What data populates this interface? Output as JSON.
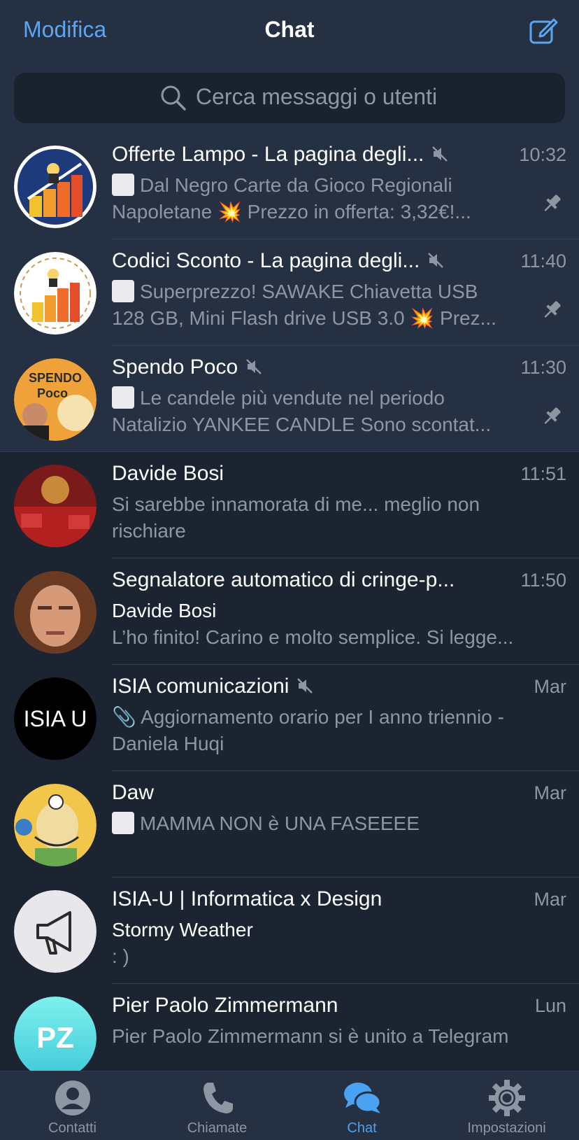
{
  "header": {
    "edit_label": "Modifica",
    "title": "Chat",
    "compose_icon": "compose-icon"
  },
  "search": {
    "placeholder": "Cerca messaggi o utenti"
  },
  "colors": {
    "accent": "#5aa6f5",
    "background": "#1c2431",
    "pinned_background": "#253042",
    "secondary_text": "#8e96a3"
  },
  "chats": [
    {
      "name": "Offerte Lampo - La pagina degli...",
      "time": "10:32",
      "muted": true,
      "pinned": true,
      "line1": "Dal Negro Carte da Gioco Regionali",
      "line2": "Napoletane 💥 Prezzo in offerta: 3,32€!..."
    },
    {
      "name": "Codici Sconto - La pagina degli...",
      "time": "11:40",
      "muted": true,
      "pinned": true,
      "line1": "Superprezzo! SAWAKE Chiavetta USB",
      "line2": "128 GB, Mini Flash drive USB 3.0 💥 Prez..."
    },
    {
      "name": "Spendo Poco",
      "time": "11:30",
      "muted": true,
      "pinned": true,
      "line1": "Le candele più vendute  nel periodo",
      "line2": "Natalizio YANKEE CANDLE  Sono scontat..."
    },
    {
      "name": "Davide Bosi",
      "time": "11:51",
      "line1": "Si sarebbe innamorata di me... meglio non",
      "line2": "rischiare"
    },
    {
      "name": "Segnalatore automatico di cringe-p...",
      "time": "11:50",
      "sender": "Davide Bosi",
      "line2": "L’ho finito! Carino e molto semplice. Si legge..."
    },
    {
      "name": "ISIA comunicazioni",
      "time": "Mar",
      "muted": true,
      "avatar_text": "ISIA U",
      "line1": "📎 Aggiornamento orario per  I anno triennio -",
      "line2": "Daniela Huqi"
    },
    {
      "name": "Daw",
      "time": "Mar",
      "line1": "MAMMA NON è UNA FASEEEE"
    },
    {
      "name": "ISIA-U | Informatica x Design",
      "time": "Mar",
      "sender": "Stormy Weather",
      "line2": ": )"
    },
    {
      "name": "Pier Paolo Zimmermann",
      "time": "Lun",
      "avatar_text": "PZ",
      "line1": "Pier Paolo Zimmermann si è unito a Telegram"
    }
  ],
  "tabs": [
    {
      "label": "Contatti",
      "icon": "person-icon"
    },
    {
      "label": "Chiamate",
      "icon": "phone-icon"
    },
    {
      "label": "Chat",
      "icon": "chat-bubbles-icon",
      "active": true
    },
    {
      "label": "Impostazioni",
      "icon": "gear-icon"
    }
  ]
}
